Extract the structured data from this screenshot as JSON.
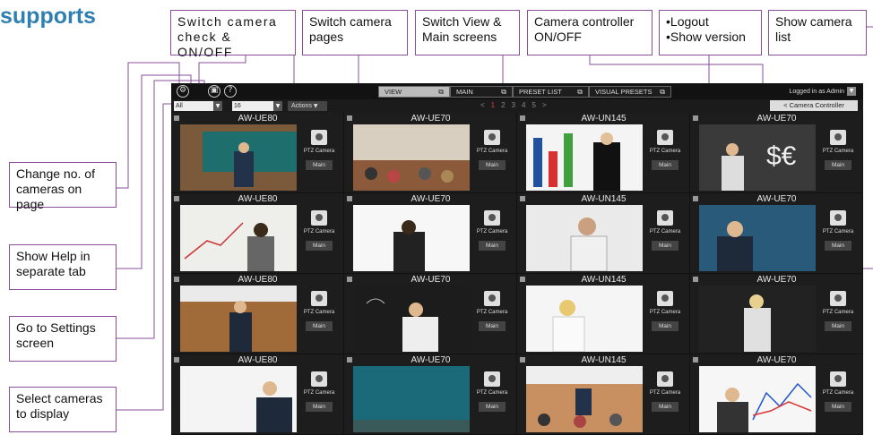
{
  "heading": "supports",
  "callouts": {
    "switch_camera_check": "Switch camera\ncheck & ON/OFF",
    "switch_camera_pages": "Switch camera\npages",
    "switch_view_main": "Switch View &\nMain screens",
    "camera_controller": "Camera controller\nON/OFF",
    "logout_version": "•Logout\n•Show version",
    "show_camera_list": "Show camera\nlist",
    "change_no_cameras": "Change no. of\ncameras on page",
    "show_help": "Show Help in\nseparate tab",
    "go_settings": "Go to Settings\nscreen",
    "select_cameras": "Select cameras\nto display"
  },
  "app": {
    "tabs": [
      {
        "label": "VIEW"
      },
      {
        "label": "MAIN"
      },
      {
        "label": "PRESET LIST"
      },
      {
        "label": "VISUAL PRESETS"
      }
    ],
    "login_text": "Logged in as Admin",
    "group_select": "All",
    "count_select": "16",
    "actions_label": "Actions",
    "pages": [
      "<",
      "1",
      "2",
      "3",
      "4",
      "5",
      ">"
    ],
    "camera_controller_label": "< Camera Controller",
    "ptz_label": "PTZ Camera",
    "main_label": "Main",
    "cameras": [
      {
        "name": "AW-UE80"
      },
      {
        "name": "AW-UE70"
      },
      {
        "name": "AW-UN145"
      },
      {
        "name": "AW-UE70"
      },
      {
        "name": "AW-UE80"
      },
      {
        "name": "AW-UE70"
      },
      {
        "name": "AW-UN145"
      },
      {
        "name": "AW-UE70"
      },
      {
        "name": "AW-UE80"
      },
      {
        "name": "AW-UE70"
      },
      {
        "name": "AW-UN145"
      },
      {
        "name": "AW-UE70"
      },
      {
        "name": "AW-UE80"
      },
      {
        "name": "AW-UE70"
      },
      {
        "name": "AW-UN145"
      },
      {
        "name": "AW-UE70"
      }
    ]
  },
  "colors": {
    "accent": "#8a4f99",
    "heading": "#2f7fb0",
    "page_current": "#e03a3a"
  }
}
